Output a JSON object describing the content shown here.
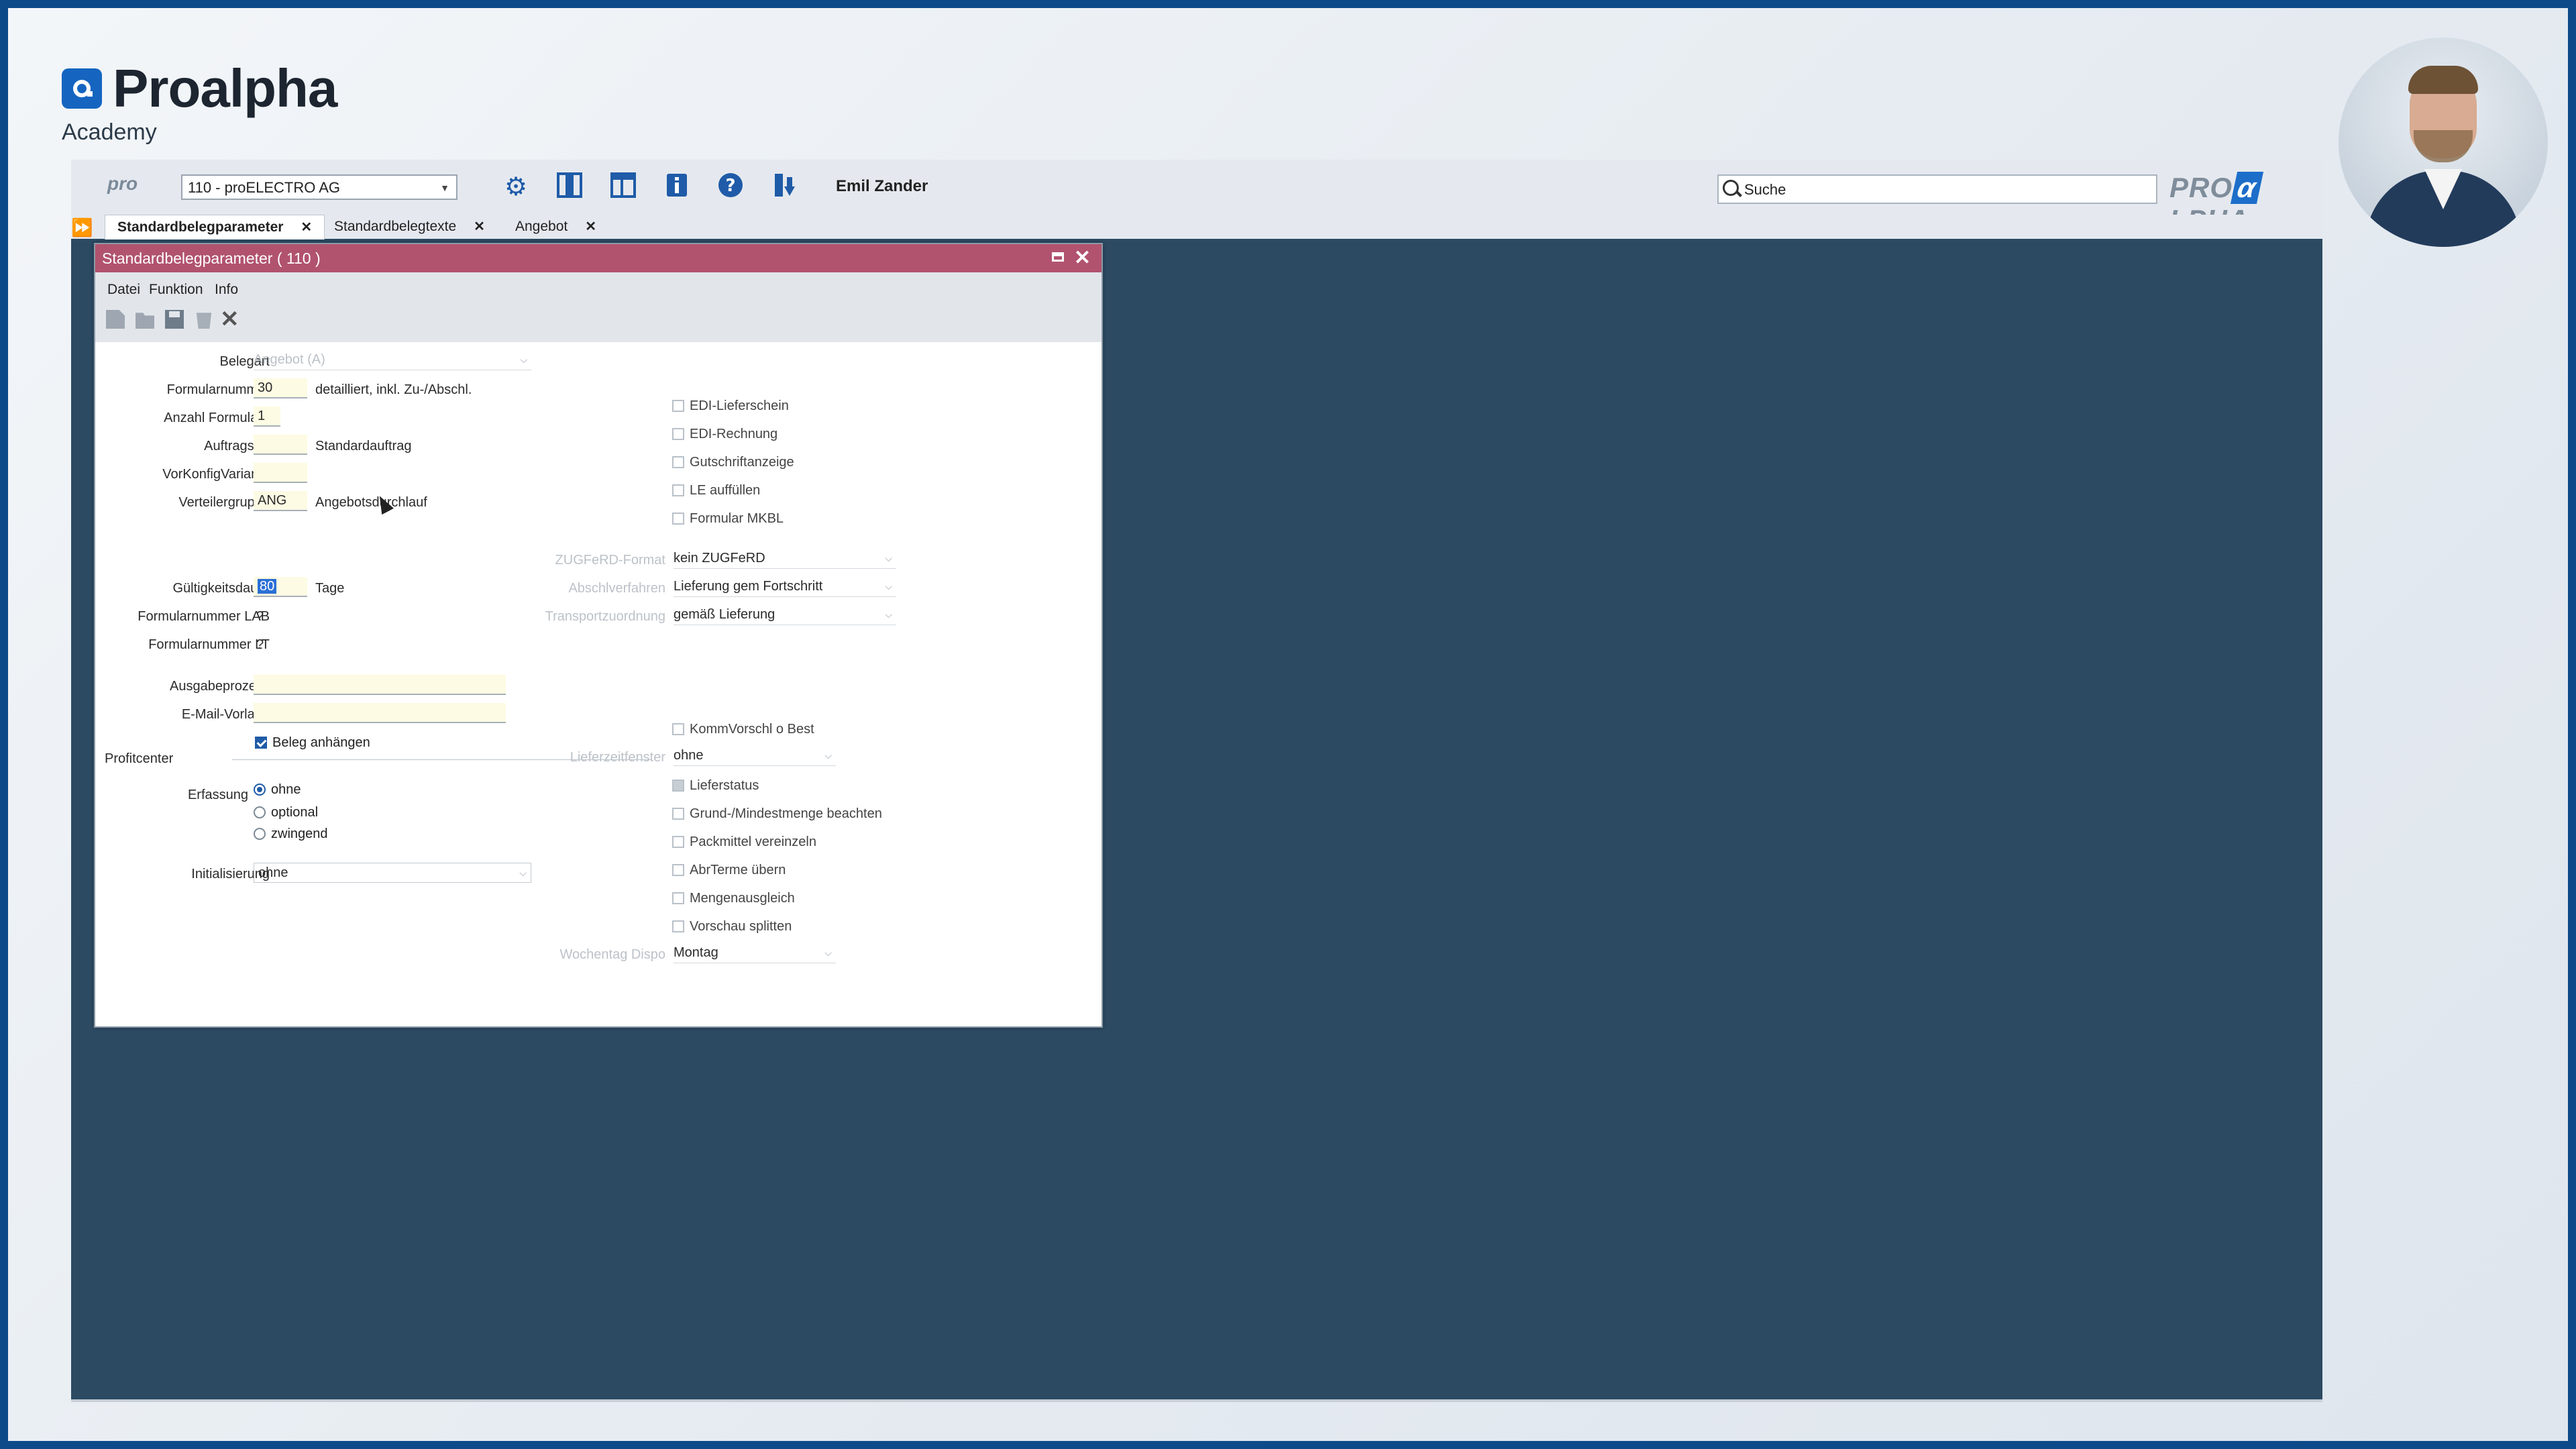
{
  "branding": {
    "logo_text": "Proalpha",
    "sub_text": "Academy",
    "pro_small": "pro",
    "brand_pre": "PRO",
    "brand_mid": "α",
    "brand_post": "LPHA"
  },
  "toolbar": {
    "company": "110 - proELECTRO AG",
    "user": "Emil Zander",
    "search_placeholder": "Suche",
    "icons": [
      "gear-icon",
      "panel-icon",
      "layout-icon",
      "info-icon",
      "help-icon",
      "export-icon"
    ]
  },
  "tabs": [
    {
      "label": "Standardbelegparameter",
      "active": true
    },
    {
      "label": "Standardbelegtexte",
      "active": false
    },
    {
      "label": "Angebot",
      "active": false
    }
  ],
  "window": {
    "title": "Standardbelegparameter ( 110 )",
    "menu": [
      "Datei",
      "Funktion",
      "Info"
    ]
  },
  "form": {
    "belegart": {
      "label": "Belegart",
      "value": "Angebot (A)"
    },
    "formularnummer": {
      "label": "Formularnummer",
      "value": "30",
      "desc": "detailliert, inkl. Zu-/Abschl."
    },
    "anzahl_formulare": {
      "label": "Anzahl Formulare",
      "value": "1"
    },
    "auftragsart": {
      "label": "Auftragsart",
      "value": "",
      "desc": "Standardauftrag"
    },
    "vorkonfig": {
      "label": "VorKonfigVariante",
      "value": ""
    },
    "verteilergruppe": {
      "label": "Verteilergruppe",
      "value": "ANG",
      "desc": "Angebotsdurchlauf"
    },
    "gueltigkeitsdauer": {
      "label": "Gültigkeitsdauer",
      "value": "80",
      "unit": "Tage"
    },
    "formnr_lab": {
      "label": "Formularnummer LAB",
      "value": "?"
    },
    "formnr_lt": {
      "label": "Formularnummer LT",
      "value": "?"
    },
    "ausgabeprozess": {
      "label": "Ausgabeprozess",
      "value": ""
    },
    "email_vorlage": {
      "label": "E-Mail-Vorlage",
      "value": ""
    },
    "beleg_anhaengen": {
      "label": "Beleg anhängen",
      "checked": true
    },
    "profitcenter": {
      "label": "Profitcenter"
    },
    "erfassung": {
      "label": "Erfassung",
      "options": [
        "ohne",
        "optional",
        "zwingend"
      ],
      "selected": "ohne"
    },
    "initialisierung": {
      "label": "Initialisierung",
      "value": "ohne"
    },
    "checks_top": [
      "EDI-Lieferschein",
      "EDI-Rechnung",
      "Gutschriftanzeige",
      "LE auffüllen",
      "Formular MKBL"
    ],
    "zugferd": {
      "label": "ZUGFeRD-Format",
      "value": "kein ZUGFeRD"
    },
    "abschlag": {
      "label": "Abschlverfahren",
      "value": "Lieferung gem Fortschritt"
    },
    "transport": {
      "label": "Transportzuordnung",
      "value": "gemäß Lieferung"
    },
    "kommvorschl": {
      "label": "KommVorschl o Best"
    },
    "liefer_fenster": {
      "label": "Lieferzeitfenster",
      "value": "ohne"
    },
    "checks_bottom": [
      "Lieferstatus",
      "Grund-/Mindestmenge beachten",
      "Packmittel vereinzeln",
      "AbrTerme übern",
      "Mengenausgleich",
      "Vorschau splitten"
    ],
    "wochentag": {
      "label": "Wochentag Dispo",
      "value": "Montag"
    }
  }
}
